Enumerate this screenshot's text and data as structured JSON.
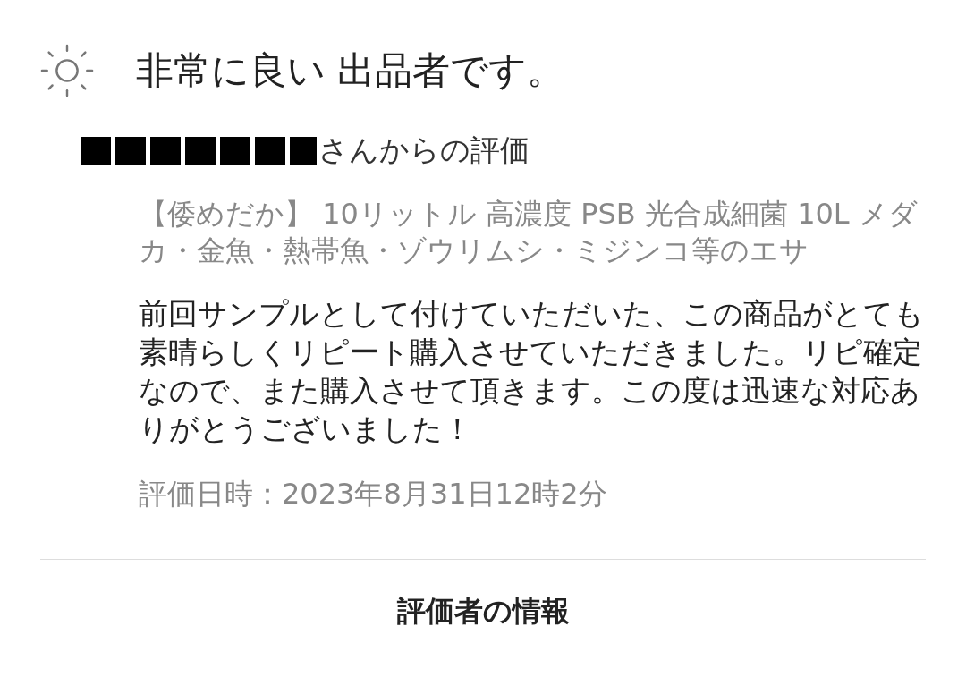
{
  "rating": {
    "label": "非常に良い 出品者です。"
  },
  "reviewer": {
    "redacted": true,
    "suffix": "さんからの評価"
  },
  "product": {
    "title": "【倭めだか】 10リットル 高濃度 PSB 光合成細菌 10L メダカ・金魚・熱帯魚・ゾウリムシ・ミジンコ等のエサ"
  },
  "comment": "前回サンプルとして付けていただいた、この商品がとても素晴らしくリピート購入させていただきました。リピ確定なので、また購入させて頂きます。この度は迅速な対応ありがとうございました！",
  "date": "評価日時：2023年8月31日12時2分",
  "section_heading": "評価者の情報"
}
